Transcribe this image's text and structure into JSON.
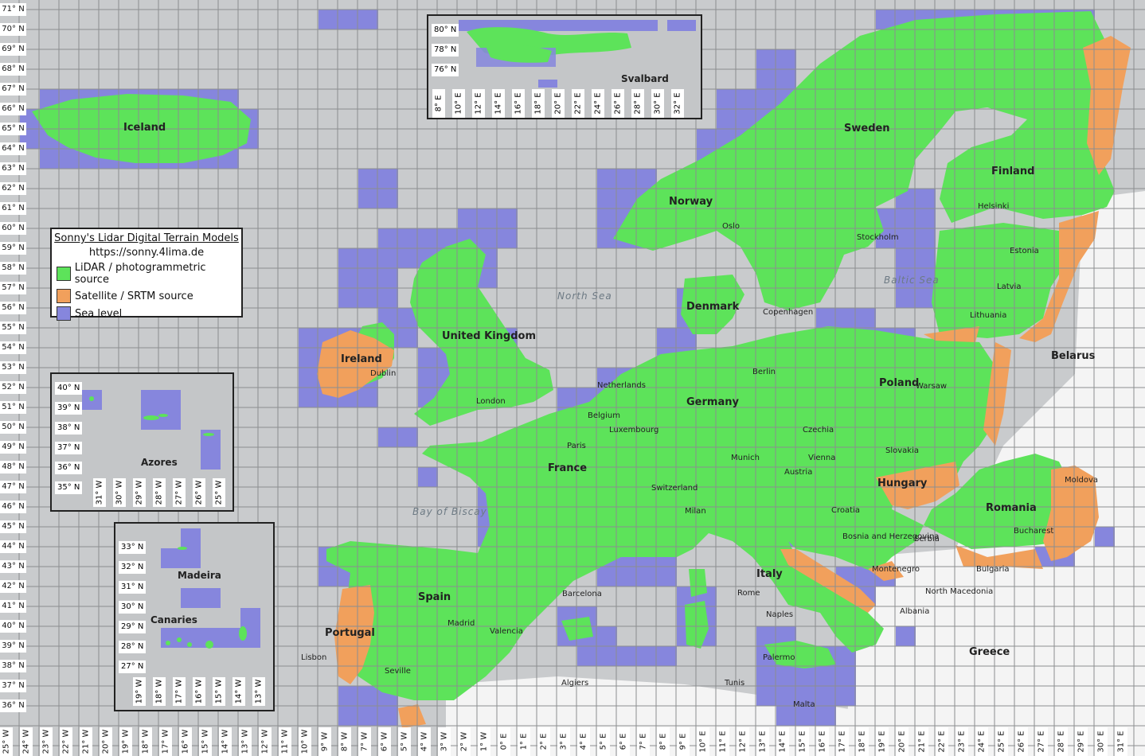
{
  "legend": {
    "title": "Sonny's Lidar Digital Terrain Models",
    "url": "https://sonny.4lima.de",
    "items": [
      {
        "label": "LiDAR / photogrammetric source",
        "color": "#5de35a"
      },
      {
        "label": "Satellite / SRTM source",
        "color": "#f1a05c"
      },
      {
        "label": "Sea level",
        "color": "#8686dd"
      }
    ]
  },
  "colors": {
    "lidar": "#5de35a",
    "srtm": "#f1a05c",
    "sea": "#8686dd",
    "ocean": "#c9cbcd",
    "land_other": "#f4f4f4",
    "grid": "#8c8e90"
  },
  "lat_labels": [
    "71° N",
    "70° N",
    "69° N",
    "68° N",
    "67° N",
    "66° N",
    "65° N",
    "64° N",
    "63° N",
    "62° N",
    "61° N",
    "60° N",
    "59° N",
    "58° N",
    "57° N",
    "56° N",
    "55° N",
    "54° N",
    "53° N",
    "52° N",
    "51° N",
    "50° N",
    "49° N",
    "48° N",
    "47° N",
    "46° N",
    "45° N",
    "44° N",
    "43° N",
    "42° N",
    "41° N",
    "40° N",
    "39° N",
    "38° N",
    "37° N",
    "36° N"
  ],
  "lon_labels": [
    "25° W",
    "24° W",
    "23° W",
    "22° W",
    "21° W",
    "20° W",
    "19° W",
    "18° W",
    "17° W",
    "16° W",
    "15° W",
    "14° W",
    "13° W",
    "12° W",
    "11° W",
    "10° W",
    "9° W",
    "8° W",
    "7° W",
    "6° W",
    "5° W",
    "4° W",
    "3° W",
    "2° W",
    "1° W",
    "0° E",
    "1° E",
    "2° E",
    "3° E",
    "4° E",
    "5° E",
    "6° E",
    "7° E",
    "8° E",
    "9° E",
    "10° E",
    "11° E",
    "12° E",
    "13° E",
    "14° E",
    "15° E",
    "16° E",
    "17° E",
    "18° E",
    "19° E",
    "20° E",
    "21° E",
    "22° E",
    "23° E",
    "24° E",
    "25° E",
    "26° E",
    "27° E",
    "28° E",
    "29° E",
    "30° E",
    "31° E"
  ],
  "insets": {
    "svalbard": {
      "name": "Svalbard",
      "lat": [
        "80° N",
        "78° N",
        "76° N"
      ],
      "lon": [
        "8° E",
        "10° E",
        "12° E",
        "14° E",
        "16° E",
        "18° E",
        "20° E",
        "22° E",
        "24° E",
        "26° E",
        "28° E",
        "30° E",
        "32° E"
      ]
    },
    "azores": {
      "name": "Azores",
      "lat": [
        "40° N",
        "39° N",
        "38° N",
        "37° N",
        "36° N",
        "35° N"
      ],
      "lon": [
        "31° W",
        "30° W",
        "29° W",
        "28° W",
        "27° W",
        "26° W",
        "25° W"
      ]
    },
    "canaries": {
      "names": [
        "Madeira",
        "Canaries"
      ],
      "lat": [
        "33° N",
        "32° N",
        "31° N",
        "30° N",
        "29° N",
        "28° N",
        "27° N"
      ],
      "lon": [
        "19° W",
        "18° W",
        "17° W",
        "16° W",
        "15° W",
        "14° W",
        "13° W"
      ]
    }
  },
  "places": [
    {
      "text": "Iceland",
      "type": "country"
    },
    {
      "text": "Norway",
      "type": "country"
    },
    {
      "text": "Sweden",
      "type": "country"
    },
    {
      "text": "Finland",
      "type": "country"
    },
    {
      "text": "Estonia",
      "type": "city"
    },
    {
      "text": "Latvia",
      "type": "city"
    },
    {
      "text": "Lithuania",
      "type": "city"
    },
    {
      "text": "Denmark",
      "type": "country"
    },
    {
      "text": "United Kingdom",
      "type": "country"
    },
    {
      "text": "Ireland",
      "type": "country"
    },
    {
      "text": "Netherlands",
      "type": "city"
    },
    {
      "text": "Belgium",
      "type": "city"
    },
    {
      "text": "Luxembourg",
      "type": "city"
    },
    {
      "text": "Germany",
      "type": "country"
    },
    {
      "text": "Poland",
      "type": "country"
    },
    {
      "text": "Belarus",
      "type": "country"
    },
    {
      "text": "Czechia",
      "type": "city"
    },
    {
      "text": "Slovakia",
      "type": "city"
    },
    {
      "text": "Austria",
      "type": "city"
    },
    {
      "text": "Hungary",
      "type": "country"
    },
    {
      "text": "Romania",
      "type": "country"
    },
    {
      "text": "Moldova",
      "type": "city"
    },
    {
      "text": "France",
      "type": "country"
    },
    {
      "text": "Switzerland",
      "type": "city"
    },
    {
      "text": "Italy",
      "type": "country"
    },
    {
      "text": "Croatia",
      "type": "city"
    },
    {
      "text": "Bosnia and Herzegovina",
      "type": "city"
    },
    {
      "text": "Serbia",
      "type": "city"
    },
    {
      "text": "Bulgaria",
      "type": "city"
    },
    {
      "text": "Montenegro",
      "type": "city"
    },
    {
      "text": "North Macedonia",
      "type": "city"
    },
    {
      "text": "Albania",
      "type": "city"
    },
    {
      "text": "Greece",
      "type": "country"
    },
    {
      "text": "Spain",
      "type": "country"
    },
    {
      "text": "Portugal",
      "type": "country"
    },
    {
      "text": "North Sea",
      "type": "sea"
    },
    {
      "text": "Bay of Biscay",
      "type": "sea"
    },
    {
      "text": "Baltic Sea",
      "type": "sea"
    },
    {
      "text": "London",
      "type": "city"
    },
    {
      "text": "Paris",
      "type": "city"
    },
    {
      "text": "Madrid",
      "type": "city"
    },
    {
      "text": "Berlin",
      "type": "city"
    },
    {
      "text": "Rome",
      "type": "city"
    },
    {
      "text": "Oslo",
      "type": "city"
    },
    {
      "text": "Stockholm",
      "type": "city"
    },
    {
      "text": "Helsinki",
      "type": "city"
    },
    {
      "text": "Copenhagen",
      "type": "city"
    },
    {
      "text": "Vienna",
      "type": "city"
    },
    {
      "text": "Warsaw",
      "type": "city"
    },
    {
      "text": "Bucharest",
      "type": "city"
    },
    {
      "text": "Munich",
      "type": "city"
    },
    {
      "text": "Milan",
      "type": "city"
    },
    {
      "text": "Barcelona",
      "type": "city"
    },
    {
      "text": "Lisbon",
      "type": "city"
    },
    {
      "text": "Dublin",
      "type": "city"
    },
    {
      "text": "Naples",
      "type": "city"
    },
    {
      "text": "Palermo",
      "type": "city"
    },
    {
      "text": "Valencia",
      "type": "city"
    },
    {
      "text": "Seville",
      "type": "city"
    },
    {
      "text": "Algiers",
      "type": "city"
    },
    {
      "text": "Tunis",
      "type": "city"
    },
    {
      "text": "Malta",
      "type": "city"
    }
  ]
}
